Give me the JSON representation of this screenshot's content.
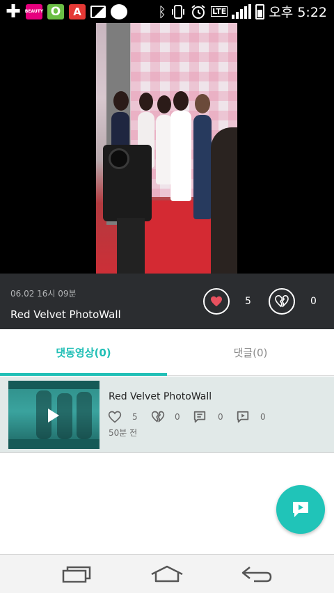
{
  "status_bar": {
    "time": "오후 5:22",
    "lte_label": "LTE",
    "notification_icons": [
      "plus-icon",
      "beauty-app-icon",
      "opera-icon",
      "a-app-icon",
      "gallery-icon",
      "bear-app-icon"
    ],
    "system_icons": [
      "bluetooth-icon",
      "vibrate-icon",
      "alarm-icon",
      "lte-icon",
      "signal-icon",
      "battery-icon"
    ],
    "beauty_label": "BEAUTY",
    "opera_label": "O",
    "a_label": "A"
  },
  "video": {
    "date": "06.02 16시 09분",
    "title": "Red Velvet PhotoWall",
    "like_count": "5",
    "dislike_count": "0",
    "like_icon": "heart-filled-icon",
    "dislike_icon": "broken-heart-icon"
  },
  "tabs": [
    {
      "label": "댓동영상(0)",
      "active": true
    },
    {
      "label": "댓글(0)",
      "active": false
    }
  ],
  "list": {
    "items": [
      {
        "title": "Red Velvet PhotoWall",
        "likes": "5",
        "dislikes": "0",
        "comments": "0",
        "replies": "0",
        "time": "50분 전"
      }
    ]
  },
  "fab": {
    "icon": "comment-play-icon"
  },
  "nav": {
    "icons": [
      "recent-apps-icon",
      "home-icon",
      "back-icon"
    ]
  },
  "colors": {
    "accent": "#20bfb6",
    "info_bar_bg": "#2b2d30",
    "list_bg": "#e1e9e8",
    "heart": "#e8515f"
  }
}
